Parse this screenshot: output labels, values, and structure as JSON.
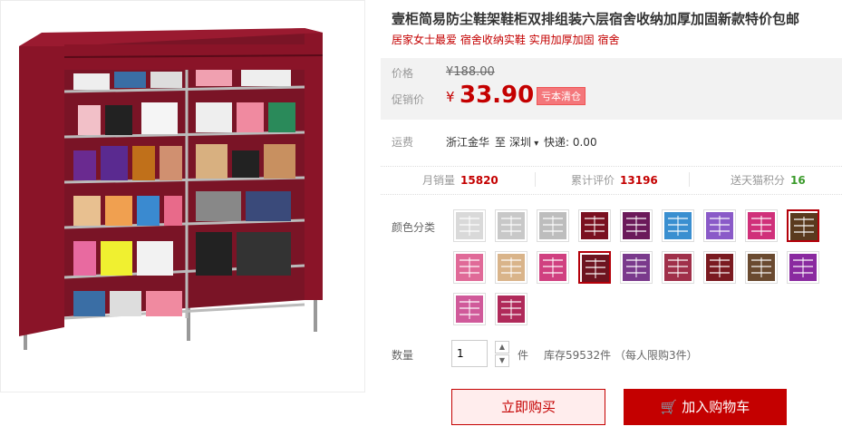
{
  "product": {
    "title": "壹柜简易防尘鞋架鞋柜双排组装六层宿舍收纳加厚加固新款特价包邮",
    "subtitle": "居家女士最爱 宿舍收纳实鞋 实用加厚加固 宿舍"
  },
  "price": {
    "label": "价格",
    "original": "¥188.00",
    "promo_label": "促销价",
    "currency": "¥",
    "value": "33.90",
    "badge": "亏本清仓"
  },
  "shipping": {
    "label": "运费",
    "from": "浙江金华",
    "to_word": "至",
    "destination": "深圳",
    "express": "快递: 0.00"
  },
  "stats": {
    "monthly_sales_label": "月销量",
    "monthly_sales": "15820",
    "reviews_label": "累计评价",
    "reviews": "13196",
    "points_label": "送天猫积分",
    "points": "16"
  },
  "colors": {
    "label": "颜色分类",
    "swatches": [
      "#d9d9d9",
      "#c8c8c8",
      "#bdbdbd",
      "#7a1020",
      "#6b1a5a",
      "#3a8fd0",
      "#8a5ac8",
      "#d0307a",
      "#5a3a1e",
      "#e06a98",
      "#d9b48a",
      "#d04080",
      "#6e1420",
      "#7a3a8c",
      "#a0304a",
      "#7a1a20",
      "#6a4a30",
      "#8a2aa0",
      "#d05a9a",
      "#b02a5a"
    ],
    "selected_index": 12,
    "selected_top_index": 8
  },
  "quantity": {
    "label": "数量",
    "value": "1",
    "unit": "件",
    "stock": "库存59532件 （每人限购3件）"
  },
  "actions": {
    "buy_now": "立即购买",
    "add_to_cart": "加入购物车"
  },
  "accent_color": "#c40000"
}
